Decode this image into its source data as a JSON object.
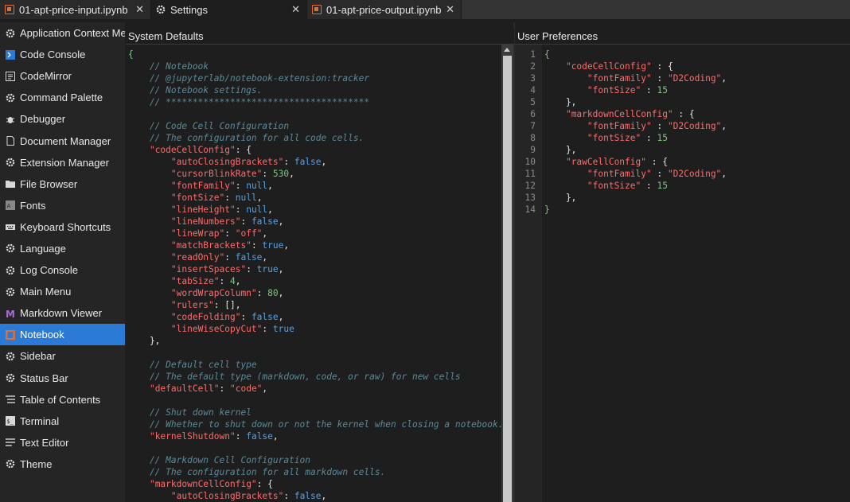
{
  "tabs": [
    {
      "label": "01-apt-price-input.ipynb",
      "icon": "notebook-icon",
      "active": false
    },
    {
      "label": "Settings",
      "icon": "gear-icon",
      "active": true
    },
    {
      "label": "01-apt-price-output.ipynb",
      "icon": "notebook-icon",
      "active": false
    }
  ],
  "tab_close_glyph": "✕",
  "sidebar": {
    "items": [
      {
        "label": "Application Context Menu",
        "icon": "gear-icon"
      },
      {
        "label": "Code Console",
        "icon": "console-icon"
      },
      {
        "label": "CodeMirror",
        "icon": "editor-icon"
      },
      {
        "label": "Command Palette",
        "icon": "gear-icon"
      },
      {
        "label": "Debugger",
        "icon": "bug-icon"
      },
      {
        "label": "Document Manager",
        "icon": "file-icon"
      },
      {
        "label": "Extension Manager",
        "icon": "puzzle-icon"
      },
      {
        "label": "File Browser",
        "icon": "folder-icon"
      },
      {
        "label": "Fonts",
        "icon": "font-icon"
      },
      {
        "label": "Keyboard Shortcuts",
        "icon": "keyboard-icon"
      },
      {
        "label": "Language",
        "icon": "gear-icon"
      },
      {
        "label": "Log Console",
        "icon": "gear-icon"
      },
      {
        "label": "Main Menu",
        "icon": "gear-icon"
      },
      {
        "label": "Markdown Viewer",
        "icon": "markdown-icon"
      },
      {
        "label": "Notebook",
        "icon": "notebook-icon",
        "selected": true
      },
      {
        "label": "Sidebar",
        "icon": "gear-icon"
      },
      {
        "label": "Status Bar",
        "icon": "gear-icon"
      },
      {
        "label": "Table of Contents",
        "icon": "list-icon"
      },
      {
        "label": "Terminal",
        "icon": "terminal-icon"
      },
      {
        "label": "Text Editor",
        "icon": "text-editor-icon"
      },
      {
        "label": "Theme",
        "icon": "gear-icon"
      }
    ]
  },
  "system_defaults": {
    "title": "System Defaults",
    "lines": [
      [
        [
          "br",
          "{"
        ]
      ],
      [
        [
          "cm",
          "    // Notebook"
        ]
      ],
      [
        [
          "cm",
          "    // @jupyterlab/notebook-extension:tracker"
        ]
      ],
      [
        [
          "cm",
          "    // Notebook settings."
        ]
      ],
      [
        [
          "cm",
          "    // **************************************"
        ]
      ],
      [
        [
          "p",
          ""
        ]
      ],
      [
        [
          "cm",
          "    // Code Cell Configuration"
        ]
      ],
      [
        [
          "cm",
          "    // The configuration for all code cells."
        ]
      ],
      [
        [
          "p",
          "    "
        ],
        [
          "key",
          "\"codeCellConfig\""
        ],
        [
          "p",
          ": {"
        ]
      ],
      [
        [
          "p",
          "        "
        ],
        [
          "key",
          "\"autoClosingBrackets\""
        ],
        [
          "p",
          ": "
        ],
        [
          "kw",
          "false"
        ],
        [
          "p",
          ","
        ]
      ],
      [
        [
          "p",
          "        "
        ],
        [
          "key",
          "\"cursorBlinkRate\""
        ],
        [
          "p",
          ": "
        ],
        [
          "num",
          "530"
        ],
        [
          "p",
          ","
        ]
      ],
      [
        [
          "p",
          "        "
        ],
        [
          "key",
          "\"fontFamily\""
        ],
        [
          "p",
          ": "
        ],
        [
          "kw",
          "null"
        ],
        [
          "p",
          ","
        ]
      ],
      [
        [
          "p",
          "        "
        ],
        [
          "key",
          "\"fontSize\""
        ],
        [
          "p",
          ": "
        ],
        [
          "kw",
          "null"
        ],
        [
          "p",
          ","
        ]
      ],
      [
        [
          "p",
          "        "
        ],
        [
          "key",
          "\"lineHeight\""
        ],
        [
          "p",
          ": "
        ],
        [
          "kw",
          "null"
        ],
        [
          "p",
          ","
        ]
      ],
      [
        [
          "p",
          "        "
        ],
        [
          "key",
          "\"lineNumbers\""
        ],
        [
          "p",
          ": "
        ],
        [
          "kw",
          "false"
        ],
        [
          "p",
          ","
        ]
      ],
      [
        [
          "p",
          "        "
        ],
        [
          "key",
          "\"lineWrap\""
        ],
        [
          "p",
          ": "
        ],
        [
          "str",
          "\"off\""
        ],
        [
          "p",
          ","
        ]
      ],
      [
        [
          "p",
          "        "
        ],
        [
          "key",
          "\"matchBrackets\""
        ],
        [
          "p",
          ": "
        ],
        [
          "kw",
          "true"
        ],
        [
          "p",
          ","
        ]
      ],
      [
        [
          "p",
          "        "
        ],
        [
          "key",
          "\"readOnly\""
        ],
        [
          "p",
          ": "
        ],
        [
          "kw",
          "false"
        ],
        [
          "p",
          ","
        ]
      ],
      [
        [
          "p",
          "        "
        ],
        [
          "key",
          "\"insertSpaces\""
        ],
        [
          "p",
          ": "
        ],
        [
          "kw",
          "true"
        ],
        [
          "p",
          ","
        ]
      ],
      [
        [
          "p",
          "        "
        ],
        [
          "key",
          "\"tabSize\""
        ],
        [
          "p",
          ": "
        ],
        [
          "num",
          "4"
        ],
        [
          "p",
          ","
        ]
      ],
      [
        [
          "p",
          "        "
        ],
        [
          "key",
          "\"wordWrapColumn\""
        ],
        [
          "p",
          ": "
        ],
        [
          "num",
          "80"
        ],
        [
          "p",
          ","
        ]
      ],
      [
        [
          "p",
          "        "
        ],
        [
          "key",
          "\"rulers\""
        ],
        [
          "p",
          ": [],"
        ]
      ],
      [
        [
          "p",
          "        "
        ],
        [
          "key",
          "\"codeFolding\""
        ],
        [
          "p",
          ": "
        ],
        [
          "kw",
          "false"
        ],
        [
          "p",
          ","
        ]
      ],
      [
        [
          "p",
          "        "
        ],
        [
          "key",
          "\"lineWiseCopyCut\""
        ],
        [
          "p",
          ": "
        ],
        [
          "kw",
          "true"
        ]
      ],
      [
        [
          "p",
          "    },"
        ]
      ],
      [
        [
          "p",
          ""
        ]
      ],
      [
        [
          "cm",
          "    // Default cell type"
        ]
      ],
      [
        [
          "cm",
          "    // The default type (markdown, code, or raw) for new cells"
        ]
      ],
      [
        [
          "p",
          "    "
        ],
        [
          "key",
          "\"defaultCell\""
        ],
        [
          "p",
          ": "
        ],
        [
          "str",
          "\"code\""
        ],
        [
          "p",
          ","
        ]
      ],
      [
        [
          "p",
          ""
        ]
      ],
      [
        [
          "cm",
          "    // Shut down kernel"
        ]
      ],
      [
        [
          "cm",
          "    // Whether to shut down or not the kernel when closing a notebook."
        ]
      ],
      [
        [
          "p",
          "    "
        ],
        [
          "key",
          "\"kernelShutdown\""
        ],
        [
          "p",
          ": "
        ],
        [
          "kw",
          "false"
        ],
        [
          "p",
          ","
        ]
      ],
      [
        [
          "p",
          ""
        ]
      ],
      [
        [
          "cm",
          "    // Markdown Cell Configuration"
        ]
      ],
      [
        [
          "cm",
          "    // The configuration for all markdown cells."
        ]
      ],
      [
        [
          "p",
          "    "
        ],
        [
          "key",
          "\"markdownCellConfig\""
        ],
        [
          "p",
          ": {"
        ]
      ],
      [
        [
          "p",
          "        "
        ],
        [
          "key",
          "\"autoClosingBrackets\""
        ],
        [
          "p",
          ": "
        ],
        [
          "kw",
          "false"
        ],
        [
          "p",
          ","
        ]
      ]
    ]
  },
  "user_preferences": {
    "title": "User Preferences",
    "line_numbers": [
      "1",
      "2",
      "3",
      "4",
      "5",
      "6",
      "7",
      "8",
      "9",
      "10",
      "11",
      "12",
      "13",
      "14"
    ],
    "lines": [
      [
        [
          "br",
          "{"
        ]
      ],
      [
        [
          "p",
          "    "
        ],
        [
          "key",
          "\"codeCellConfig\""
        ],
        [
          "p",
          " : {"
        ]
      ],
      [
        [
          "p",
          "        "
        ],
        [
          "key",
          "\"fontFamily\""
        ],
        [
          "p",
          " : "
        ],
        [
          "str",
          "\"D2Coding\""
        ],
        [
          "p",
          ","
        ]
      ],
      [
        [
          "p",
          "        "
        ],
        [
          "key",
          "\"fontSize\""
        ],
        [
          "p",
          " : "
        ],
        [
          "num",
          "15"
        ]
      ],
      [
        [
          "p",
          "    },"
        ]
      ],
      [
        [
          "p",
          "    "
        ],
        [
          "key",
          "\"markdownCellConfig\""
        ],
        [
          "p",
          " : {"
        ]
      ],
      [
        [
          "p",
          "        "
        ],
        [
          "key",
          "\"fontFamily\""
        ],
        [
          "p",
          " : "
        ],
        [
          "str",
          "\"D2Coding\""
        ],
        [
          "p",
          ","
        ]
      ],
      [
        [
          "p",
          "        "
        ],
        [
          "key",
          "\"fontSize\""
        ],
        [
          "p",
          " : "
        ],
        [
          "num",
          "15"
        ]
      ],
      [
        [
          "p",
          "    },"
        ]
      ],
      [
        [
          "p",
          "    "
        ],
        [
          "key",
          "\"rawCellConfig\""
        ],
        [
          "p",
          " : {"
        ]
      ],
      [
        [
          "p",
          "        "
        ],
        [
          "key",
          "\"fontFamily\""
        ],
        [
          "p",
          " : "
        ],
        [
          "str",
          "\"D2Coding\""
        ],
        [
          "p",
          ","
        ]
      ],
      [
        [
          "p",
          "        "
        ],
        [
          "key",
          "\"fontSize\""
        ],
        [
          "p",
          " : "
        ],
        [
          "num",
          "15"
        ]
      ],
      [
        [
          "p",
          "    },"
        ]
      ],
      [
        [
          "br",
          "}"
        ]
      ]
    ]
  },
  "colors": {
    "accent": "#2b7bd6",
    "notebook_orange": "#e46e2e",
    "comment": "#5a8a9a",
    "key": "#ff6b6b",
    "number": "#7fc77f",
    "keyword": "#5aa0e0"
  }
}
